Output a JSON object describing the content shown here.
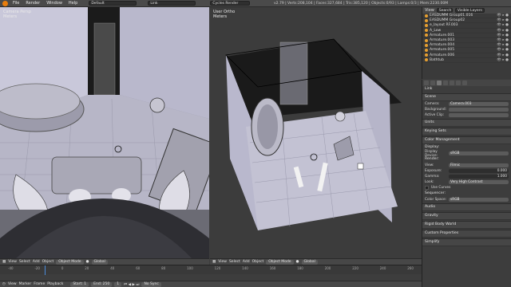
{
  "topbar": {
    "menus": [
      "File",
      "Render",
      "Window",
      "Help"
    ],
    "screen_layout": "Default",
    "scene": "Link",
    "render_engine": "Cycles Render",
    "stats": "v2.79 | Verts:208,104 | Faces:327,684 | Tris:385,120 | Objects:0/93 | Lamps:0/3 | Mem:2230.00M"
  },
  "left_viewport": {
    "view_label": "Camera Persp",
    "units_label": "Meters"
  },
  "right_viewport": {
    "view_label": "User Ortho",
    "units_label": "Meters"
  },
  "left_header": {
    "items": [
      "View",
      "Select",
      "Add",
      "Object"
    ],
    "mode": "Object Mode",
    "pivot": "Global"
  },
  "right_header": {
    "items": [
      "View",
      "Select",
      "Add",
      "Object"
    ],
    "mode": "Object Mode",
    "pivot": "Global"
  },
  "timeline": {
    "ticks": [
      "-40",
      "-20",
      "0",
      "20",
      "40",
      "60",
      "80",
      "100",
      "120",
      "140",
      "160",
      "180",
      "200",
      "220",
      "240",
      "260"
    ],
    "items": [
      "View",
      "Marker",
      "Frame",
      "Playback"
    ],
    "start_label": "Start:",
    "start_value": "1",
    "end_label": "End:",
    "end_value": "250",
    "current_frame": "1",
    "sync": "No Sync"
  },
  "outliner": {
    "tabs": [
      "View",
      "Search",
      "Visible Layers"
    ],
    "items": [
      "EASDUMM Group01.016",
      "EASDUMM Group02",
      "e_layout RF.003",
      "A_Low",
      "Armature.001",
      "Armature.003",
      "Armature.004",
      "Armature.005",
      "Armature.006",
      "Bathtub"
    ]
  },
  "properties": {
    "context": "Link",
    "scene_header": "Scene",
    "camera_label": "Camera:",
    "camera_value": "Camera.003",
    "background_label": "Background:",
    "active_clip_label": "Active Clip:",
    "sections": [
      "Units",
      "Keying Sets",
      "Color Management",
      "Audio",
      "Gravity",
      "Rigid Body World",
      "Custom Properties",
      "Simplify"
    ],
    "display_header": "Display:",
    "display_device_label": "Display Device:",
    "display_device_value": "sRGB",
    "render_header": "Render:",
    "view_label": "View:",
    "view_value": "Filmic",
    "exposure_label": "Exposure:",
    "exposure_value": "0.000",
    "gamma_label": "Gamma:",
    "gamma_value": "1.000",
    "look_label": "Look:",
    "look_value": "Very High Contrast",
    "use_curves": "Use Curves",
    "sequencer_header": "Sequencer:",
    "color_space_label": "Color Space:",
    "color_space_value": "sRGB"
  }
}
